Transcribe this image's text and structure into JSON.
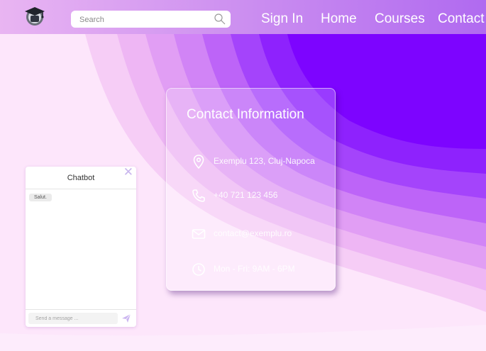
{
  "header": {
    "search_placeholder": "Search",
    "nav": [
      {
        "label": "Sign In"
      },
      {
        "label": "Home"
      },
      {
        "label": "Courses"
      },
      {
        "label": "Contact"
      }
    ]
  },
  "contact": {
    "title": "Contact Information",
    "items": [
      {
        "icon": "location-pin-icon",
        "text": "Exemplu 123, Cluj-Napoca"
      },
      {
        "icon": "phone-icon",
        "text": "+40 721 123 456"
      },
      {
        "icon": "mail-icon",
        "text": "contact@exemplu.ro"
      },
      {
        "icon": "clock-icon",
        "text": "Mon - Fri: 9AM - 6PM"
      }
    ]
  },
  "chatbot": {
    "title": "Chatbot",
    "close_glyph": "✕",
    "messages": [
      {
        "text": "Salut."
      }
    ],
    "input_placeholder": "Send a message ..."
  },
  "colors": {
    "accent": "#7a00ff",
    "nav_gradient_start": "#e9b5f2",
    "nav_gradient_end": "#b06af0",
    "page_light": "#fbe3fb"
  }
}
